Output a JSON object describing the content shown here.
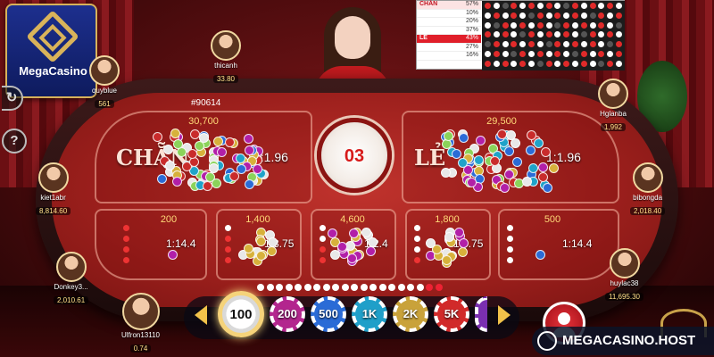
{
  "logo": {
    "text": "MegaCasino"
  },
  "watermark": {
    "text": "MEGACASINO.HOST"
  },
  "session": {
    "id": "#90614"
  },
  "timer": {
    "value": "03"
  },
  "zones": {
    "chan": {
      "label": "CHẴN",
      "odds": "1:1.96",
      "amount": "30,700"
    },
    "le": {
      "label": "LẺ",
      "odds": "1:1.96",
      "amount": "29,500"
    },
    "small": [
      {
        "odds": "1:14.4",
        "amount": "200"
      },
      {
        "odds": "1:3.75",
        "amount": "1,400"
      },
      {
        "odds": "1:2.4",
        "amount": "4,600"
      },
      {
        "odds": "1:3.75",
        "amount": "1,800"
      },
      {
        "odds": "1:14.4",
        "amount": "500"
      }
    ]
  },
  "history": {
    "rows": [
      {
        "label": "CHẴN",
        "pct": "57%",
        "type": "head"
      },
      {
        "dots": "wwww",
        "pct": "10%"
      },
      {
        "dots": "wwwr",
        "pct": "20%"
      },
      {
        "dots": "wwrr",
        "pct": "37%"
      },
      {
        "label": "LẺ",
        "pct": "43%",
        "type": "head2"
      },
      {
        "dots": "wrrr",
        "pct": "27%"
      },
      {
        "dots": "rrrr",
        "pct": "16%"
      }
    ],
    "grid_numbers": [
      "3",
      "0",
      "2",
      "2",
      "3",
      "2",
      "2",
      "0",
      "3",
      "3",
      "3"
    ]
  },
  "players": [
    {
      "name": "quyblue",
      "balance": "561"
    },
    {
      "name": "thicanh",
      "balance": "33.80"
    },
    {
      "name": "kiet1abr",
      "balance": "8,814.60"
    },
    {
      "name": "Donkey3...",
      "balance": "2,010.61"
    },
    {
      "name": "Ulfron13110",
      "balance": "0.74"
    },
    {
      "name": "Hglanba",
      "balance": "1,992"
    },
    {
      "name": "bibongda",
      "balance": "2,018.40"
    },
    {
      "name": "huylac38",
      "balance": "11,695.30"
    }
  ],
  "chips": [
    "100",
    "200",
    "500",
    "1K",
    "2K",
    "5K"
  ],
  "colors": {
    "felt": "#9b1f1c",
    "accent": "#e01f2a",
    "gold": "#f5d37a"
  }
}
